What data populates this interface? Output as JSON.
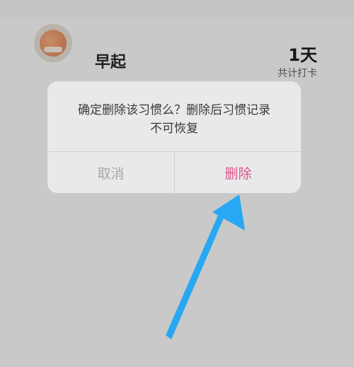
{
  "habit": {
    "name": "早起",
    "days_value": "1天",
    "days_label": "共计打卡",
    "icon": "sunrise-icon"
  },
  "dialog": {
    "message_line1": "确定删除该习惯么？删除后习惯记录",
    "message_line2": "不可恢复",
    "cancel_label": "取消",
    "delete_label": "删除"
  },
  "annotation": {
    "arrow_color": "#28a8f2",
    "arrow_icon": "pointer-arrow-icon"
  },
  "colors": {
    "overlay_bg": "#c9c9c9",
    "dialog_bg": "#e9e9e9",
    "delete_accent": "#d9568f",
    "cancel_text": "#a8a8a8"
  }
}
